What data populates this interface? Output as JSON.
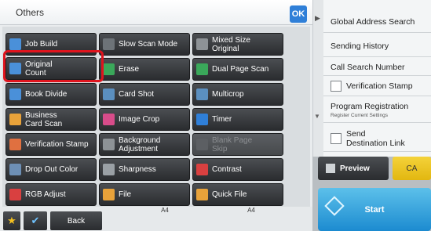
{
  "header": {
    "title": "Others",
    "ok_label": "OK"
  },
  "functions": [
    {
      "label": "Job Build",
      "icon": "job-build-icon",
      "color": "#4a90d9"
    },
    {
      "label": "Slow Scan Mode",
      "icon": "slow-scan-icon",
      "color": "#6d7378"
    },
    {
      "label": "Mixed Size\nOriginal",
      "icon": "mixed-size-icon",
      "color": "#8d9296"
    },
    {
      "label": "Original\nCount",
      "icon": "original-count-icon",
      "color": "#4a90d9"
    },
    {
      "label": "Erase",
      "icon": "erase-icon",
      "color": "#3aa85a"
    },
    {
      "label": "Dual Page Scan",
      "icon": "dual-page-icon",
      "color": "#3aa85a"
    },
    {
      "label": "Book Divide",
      "icon": "book-divide-icon",
      "color": "#4a90d9"
    },
    {
      "label": "Card Shot",
      "icon": "card-shot-icon",
      "color": "#5b8fbf"
    },
    {
      "label": "Multicrop",
      "icon": "multicrop-icon",
      "color": "#5b8fbf"
    },
    {
      "label": "Business\nCard Scan",
      "icon": "business-card-icon",
      "color": "#e8a23a"
    },
    {
      "label": "Image Crop",
      "icon": "image-crop-icon",
      "color": "#d84c8a"
    },
    {
      "label": "Timer",
      "icon": "timer-icon",
      "color": "#2f7fd8"
    },
    {
      "label": "Verification Stamp",
      "icon": "verification-stamp-icon",
      "color": "#e07040"
    },
    {
      "label": "Background\nAdjustment",
      "icon": "background-adjust-icon",
      "color": "#8d9296"
    },
    {
      "label": "Blank Page\nSkip",
      "icon": "blank-page-icon",
      "color": "#5c5f63",
      "disabled": true
    },
    {
      "label": "Drop Out Color",
      "icon": "drop-out-color-icon",
      "color": "#6d8fb5"
    },
    {
      "label": "Sharpness",
      "icon": "sharpness-icon",
      "color": "#9aa0a5"
    },
    {
      "label": "Contrast",
      "icon": "contrast-icon",
      "color": "#d94040"
    },
    {
      "label": "RGB Adjust",
      "icon": "rgb-adjust-icon",
      "color": "#d94040"
    },
    {
      "label": "File",
      "icon": "file-icon",
      "color": "#e8a23a"
    },
    {
      "label": "Quick File",
      "icon": "quick-file-icon",
      "color": "#e8a23a"
    }
  ],
  "right_panel": {
    "items": [
      {
        "label": "Global Address Search"
      },
      {
        "label": "Sending History"
      },
      {
        "label": "Call Search Number"
      },
      {
        "label": "Verification Stamp",
        "checkbox": true
      },
      {
        "label": "Program Registration",
        "sub": "Register Current Settings"
      },
      {
        "label": "Send\nDestination Link",
        "checkbox": true
      }
    ]
  },
  "actions": {
    "preview": "Preview",
    "ca": "CA",
    "start": "Start"
  },
  "bottom": {
    "back": "Back",
    "paper_left": "A4",
    "paper_right": "A4"
  }
}
